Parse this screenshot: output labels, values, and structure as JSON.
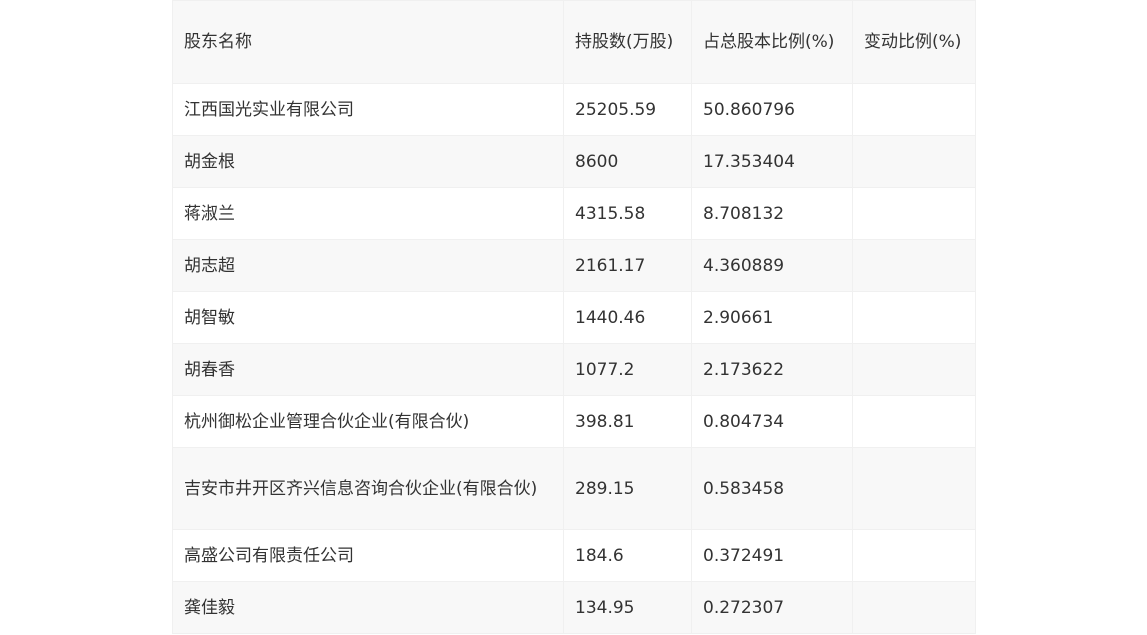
{
  "table": {
    "headers": [
      "股东名称",
      "持股数(万股)",
      "占总股本比例(%)",
      "变动比例(%)"
    ],
    "rows": [
      {
        "name": "江西国光实业有限公司",
        "shares": "25205.59",
        "ratio": "50.860796",
        "change": ""
      },
      {
        "name": "胡金根",
        "shares": "8600",
        "ratio": "17.353404",
        "change": ""
      },
      {
        "name": "蒋淑兰",
        "shares": "4315.58",
        "ratio": "8.708132",
        "change": ""
      },
      {
        "name": "胡志超",
        "shares": "2161.17",
        "ratio": "4.360889",
        "change": ""
      },
      {
        "name": "胡智敏",
        "shares": "1440.46",
        "ratio": "2.90661",
        "change": ""
      },
      {
        "name": "胡春香",
        "shares": "1077.2",
        "ratio": "2.173622",
        "change": ""
      },
      {
        "name": "杭州御松企业管理合伙企业(有限合伙)",
        "shares": "398.81",
        "ratio": "0.804734",
        "change": ""
      },
      {
        "name": "吉安市井开区齐兴信息咨询合伙企业(有限合伙)",
        "shares": "289.15",
        "ratio": "0.583458",
        "change": ""
      },
      {
        "name": "高盛公司有限责任公司",
        "shares": "184.6",
        "ratio": "0.372491",
        "change": ""
      },
      {
        "name": "龚佳毅",
        "shares": "134.95",
        "ratio": "0.272307",
        "change": ""
      }
    ]
  }
}
